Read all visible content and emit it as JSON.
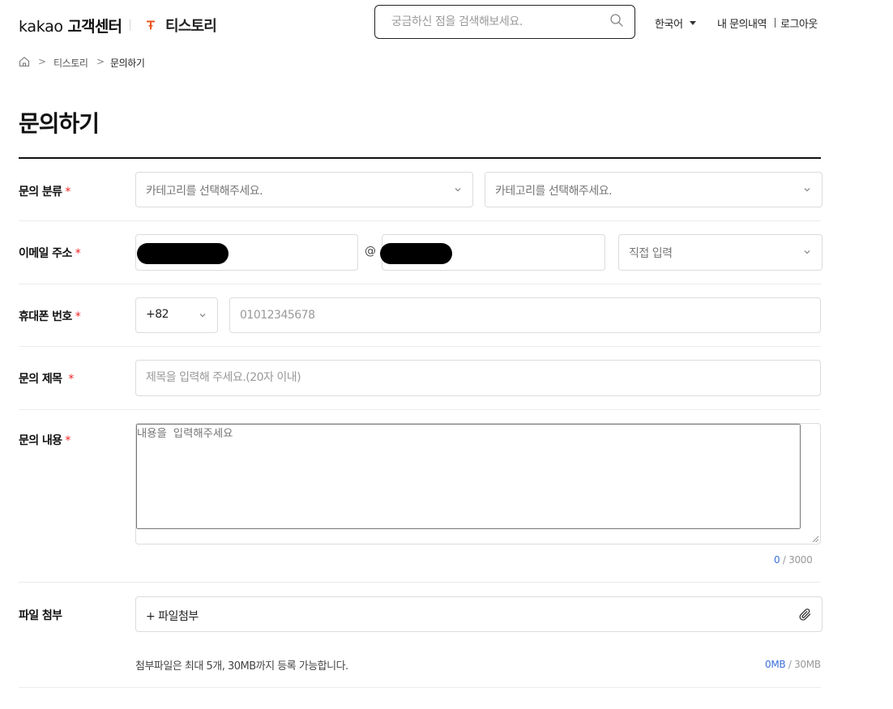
{
  "header": {
    "brand_prefix": "kakao",
    "brand_name": "고객센터",
    "service_name": "티스토리",
    "search_placeholder": "궁금하신 점을 검색해보세요.",
    "language": "한국어",
    "my_inquiries": "내 문의내역",
    "logout": "로그아웃"
  },
  "breadcrumb": {
    "home_icon": "home-icon",
    "separator": ">",
    "items": [
      "티스토리",
      "문의하기"
    ]
  },
  "page_title": "문의하기",
  "form": {
    "required_mark": "*",
    "category": {
      "label": "문의 분류",
      "placeholder_1": "카테고리를 선택해주세요.",
      "placeholder_2": "카테고리를 선택해주세요."
    },
    "email": {
      "label": "이메일 주소",
      "at": "@",
      "domain_select": "직접 입력"
    },
    "phone": {
      "label": "휴대폰 번호",
      "country_code": "+82",
      "placeholder": "01012345678"
    },
    "subject": {
      "label": "문의 제목",
      "placeholder": "제목을 입력해 주세요.(20자 이내)"
    },
    "content": {
      "label": "문의 내용",
      "placeholder": "내용을 입력해주세요",
      "count": "0",
      "max": "/ 3000"
    },
    "attachment": {
      "label": "파일 첨부",
      "button": "+ 파일첨부",
      "note": "첨부파일은 최대 5개, 30MB까지 등록 가능합니다.",
      "size_used": "0MB",
      "size_max": "/ 30MB"
    }
  },
  "colors": {
    "accent_blue": "#3a6fd8",
    "required_red": "#ee2222",
    "tistory_orange": "#eb531f"
  }
}
